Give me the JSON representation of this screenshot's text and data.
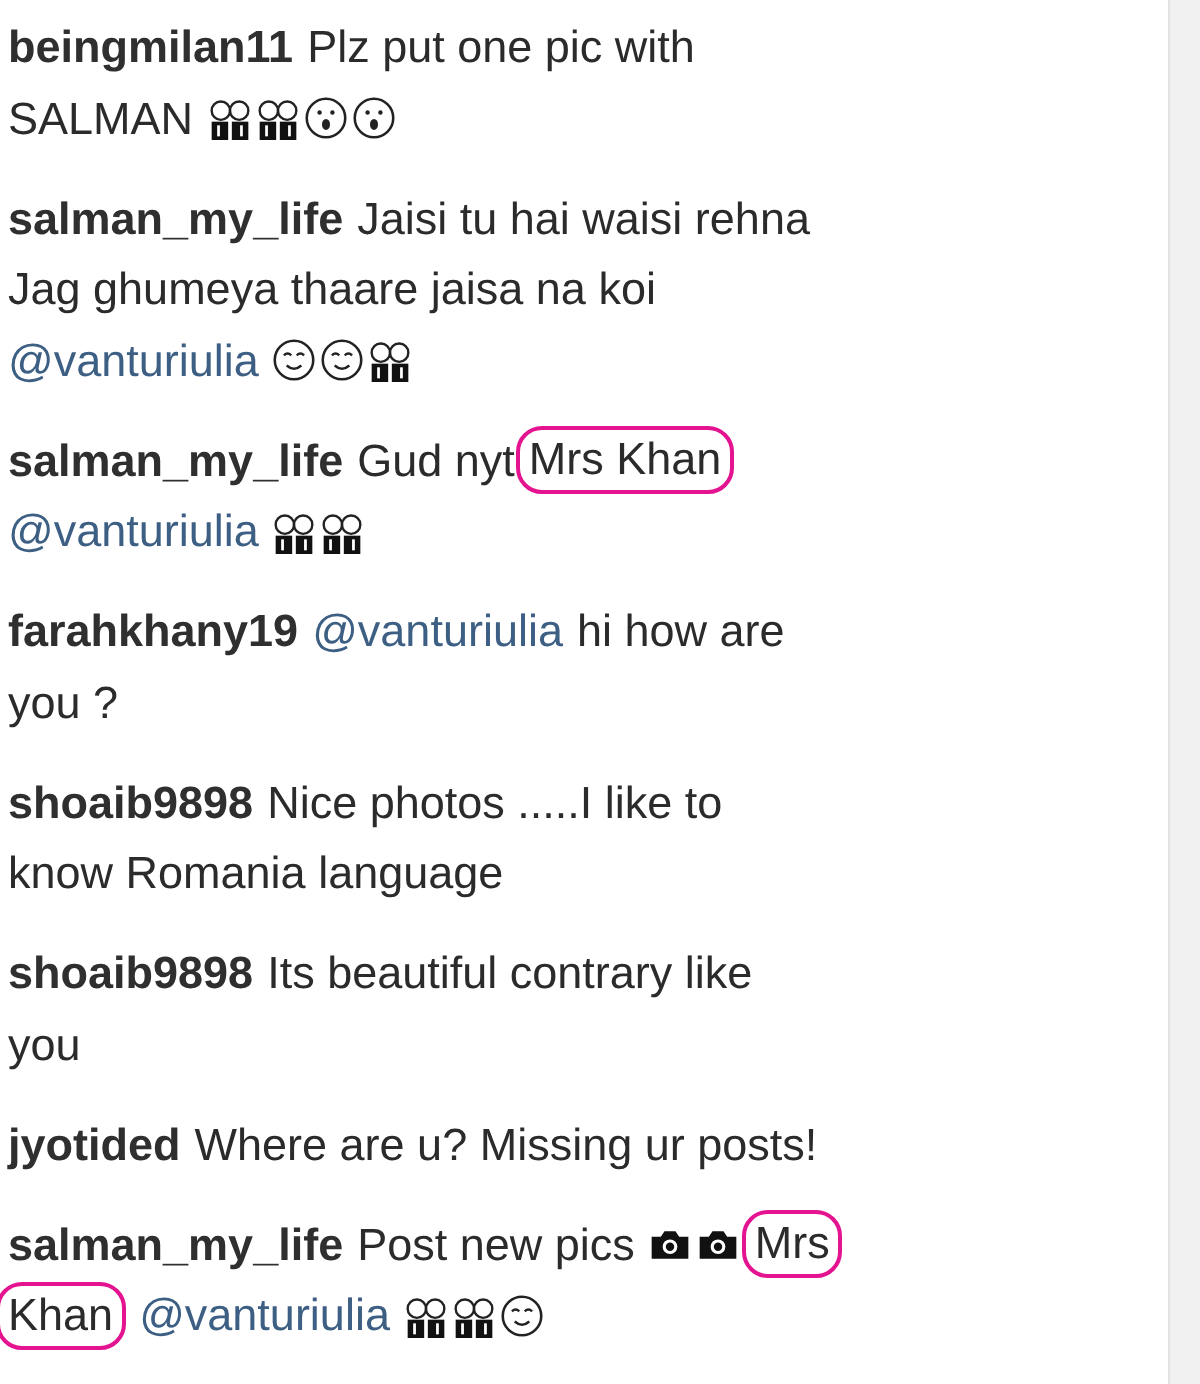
{
  "comments": [
    {
      "lines": [
        [
          {
            "kind": "user",
            "text": "beingmilan11"
          },
          {
            "kind": "text",
            "text": "Plz put one pic with"
          }
        ],
        [
          {
            "kind": "text",
            "text": "SALMAN"
          },
          {
            "kind": "figure"
          },
          {
            "kind": "figure"
          },
          {
            "kind": "surprised"
          },
          {
            "kind": "surprised"
          }
        ]
      ]
    },
    {
      "lines": [
        [
          {
            "kind": "user",
            "text": "salman_my_life"
          },
          {
            "kind": "text",
            "text": "Jaisi tu hai waisi rehna"
          }
        ],
        [
          {
            "kind": "text",
            "text": "Jag ghumeya thaare jaisa na koi"
          }
        ],
        [
          {
            "kind": "mention",
            "text": "@vanturiulia"
          },
          {
            "kind": "smile"
          },
          {
            "kind": "smile"
          },
          {
            "kind": "figure"
          }
        ]
      ]
    },
    {
      "lines": [
        [
          {
            "kind": "user",
            "text": "salman_my_life"
          },
          {
            "kind": "text",
            "text": "Gud nyt"
          },
          {
            "kind": "text",
            "text": "Mrs Khan",
            "highlighted": true
          }
        ],
        [
          {
            "kind": "mention",
            "text": "@vanturiulia"
          },
          {
            "kind": "figure"
          },
          {
            "kind": "figure"
          }
        ]
      ]
    },
    {
      "lines": [
        [
          {
            "kind": "user",
            "text": "farahkhany19"
          },
          {
            "kind": "mention",
            "text": "@vanturiulia"
          },
          {
            "kind": "text",
            "text": "hi how are"
          }
        ],
        [
          {
            "kind": "text",
            "text": "you ?"
          }
        ]
      ]
    },
    {
      "lines": [
        [
          {
            "kind": "user",
            "text": "shoaib9898"
          },
          {
            "kind": "text",
            "text": "Nice photos .....I like to"
          }
        ],
        [
          {
            "kind": "text",
            "text": "know Romania language"
          }
        ]
      ]
    },
    {
      "lines": [
        [
          {
            "kind": "user",
            "text": "shoaib9898"
          },
          {
            "kind": "text",
            "text": "Its beautiful contrary like"
          }
        ],
        [
          {
            "kind": "text",
            "text": "you"
          }
        ]
      ]
    },
    {
      "lines": [
        [
          {
            "kind": "user",
            "text": "jyotided"
          },
          {
            "kind": "text",
            "text": "Where are u? Missing ur posts!"
          }
        ]
      ]
    },
    {
      "lines": [
        [
          {
            "kind": "user",
            "text": "salman_my_life"
          },
          {
            "kind": "text",
            "text": "Post new pics"
          },
          {
            "kind": "camera"
          },
          {
            "kind": "camera"
          },
          {
            "kind": "text",
            "text": "Mrs",
            "highlighted": true
          }
        ],
        [
          {
            "kind": "text",
            "text": "Khan",
            "highlighted": true
          },
          {
            "kind": "mention",
            "text": "@vanturiulia"
          },
          {
            "kind": "figure"
          },
          {
            "kind": "figure"
          },
          {
            "kind": "smile"
          }
        ]
      ]
    }
  ]
}
